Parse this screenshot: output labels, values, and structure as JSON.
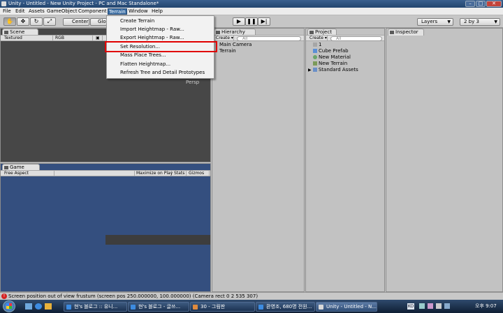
{
  "window": {
    "title": "Unity - Untitled - New Unity Project - PC and Mac Standalone*"
  },
  "menubar": {
    "items": [
      "File",
      "Edit",
      "Assets",
      "GameObject",
      "Component",
      "Terrain",
      "Window",
      "Help"
    ]
  },
  "toolbar": {
    "pivot_label": "Center",
    "space_label": "Glob",
    "layers_label": "Layers",
    "layout_label": "2 by 3"
  },
  "terrain_menu": {
    "items": [
      "Create Terrain",
      "Import Heightmap - Raw...",
      "Export Heightmap - Raw...",
      "Set Resolution...",
      "Mass Place Trees...",
      "Flatten Heightmap...",
      "Refresh Tree and Detail Prototypes"
    ],
    "highlighted": "Set Resolution..."
  },
  "scene": {
    "tab": "Scene",
    "draw_mode": "Textured",
    "render_mode": "RGB",
    "view_label": "Persp"
  },
  "game": {
    "tab": "Game",
    "aspect": "Free Aspect",
    "maximize": "Maximize on Play",
    "stats": "Stats",
    "gizmos": "Gizmos"
  },
  "hierarchy": {
    "tab": "Hierarchy",
    "create": "Create",
    "search": "All",
    "items": [
      "Main Camera",
      "Terrain"
    ]
  },
  "project": {
    "tab": "Project",
    "create": "Create",
    "search": "All",
    "items": [
      "1",
      "Cube Prefab",
      "New Material",
      "New Terrain",
      "Standard Assets"
    ]
  },
  "inspector": {
    "tab": "Inspector"
  },
  "status": {
    "message": "Screen position out of view frustum (screen pos 250.000000, 100.000000) (Camera rect 0 2 535 307)"
  },
  "taskbar": {
    "tasks": [
      "현's 블로그 :: 유니...",
      "현's 블로그 - 글쓰...",
      "30 - 그림판",
      "환영조, 680명 전원...",
      "Unity - Untitled - N..."
    ],
    "language": "KO",
    "clock": "오후 9:07"
  },
  "colors": {
    "accent": "#3a6ea5",
    "highlight_border": "#e00000",
    "game_view_bg": "#344f7f",
    "scene_view_bg": "#474747"
  }
}
